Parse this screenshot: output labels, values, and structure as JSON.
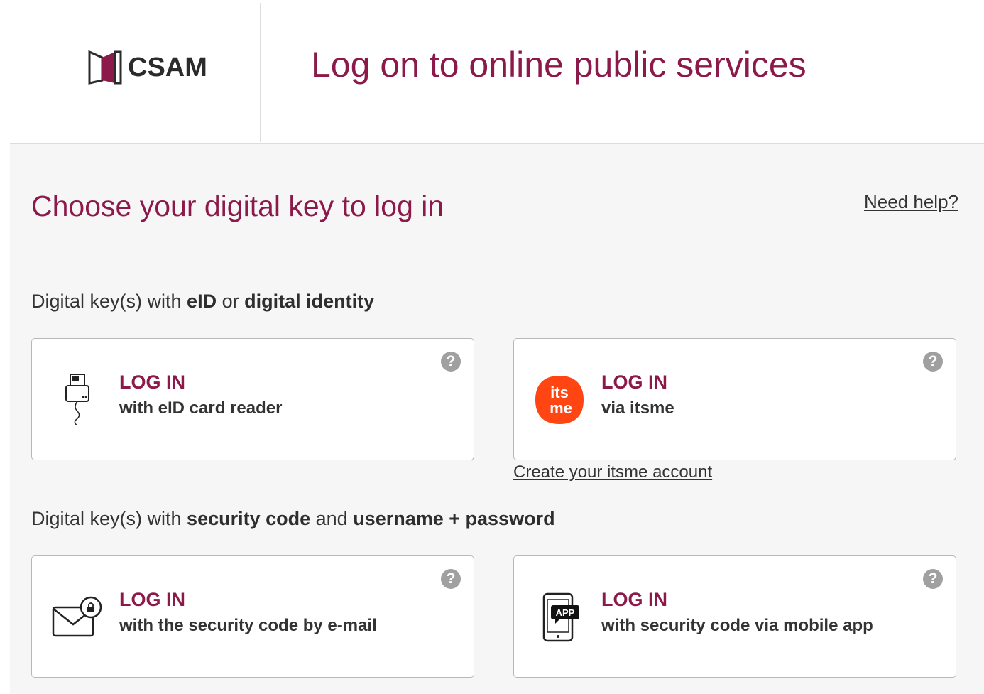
{
  "header": {
    "logo_text": "CSAM",
    "title": "Log on to online public services"
  },
  "main": {
    "heading": "Choose your digital key to log in",
    "help_link": "Need help?",
    "section1": {
      "prefix": "Digital key(s) with ",
      "bold1": "eID",
      "middle": " or ",
      "bold2": "digital identity"
    },
    "section2": {
      "prefix": "Digital key(s) with ",
      "bold1": "security code",
      "middle": " and ",
      "bold2": "username + password"
    },
    "cards": [
      {
        "title": "LOG IN",
        "subtitle": "with eID card reader",
        "icon": "eid-card-reader-icon",
        "help": "?"
      },
      {
        "title": "LOG IN",
        "subtitle": "via itsme",
        "icon": "itsme-icon",
        "help": "?",
        "icon_text_top": "its",
        "icon_text_bottom": "me"
      },
      {
        "title": "LOG IN",
        "subtitle": "with the security code by e-mail",
        "icon": "email-lock-icon",
        "help": "?"
      },
      {
        "title": "LOG IN",
        "subtitle": "with security code via mobile app",
        "icon": "mobile-app-icon",
        "help": "?",
        "icon_badge": "APP"
      }
    ],
    "create_itsme_link": "Create your itsme account"
  },
  "colors": {
    "accent": "#8b1a4a",
    "itsme": "#ff4612",
    "help_icon": "#a0a0a0",
    "background": "#f6f6f6"
  }
}
